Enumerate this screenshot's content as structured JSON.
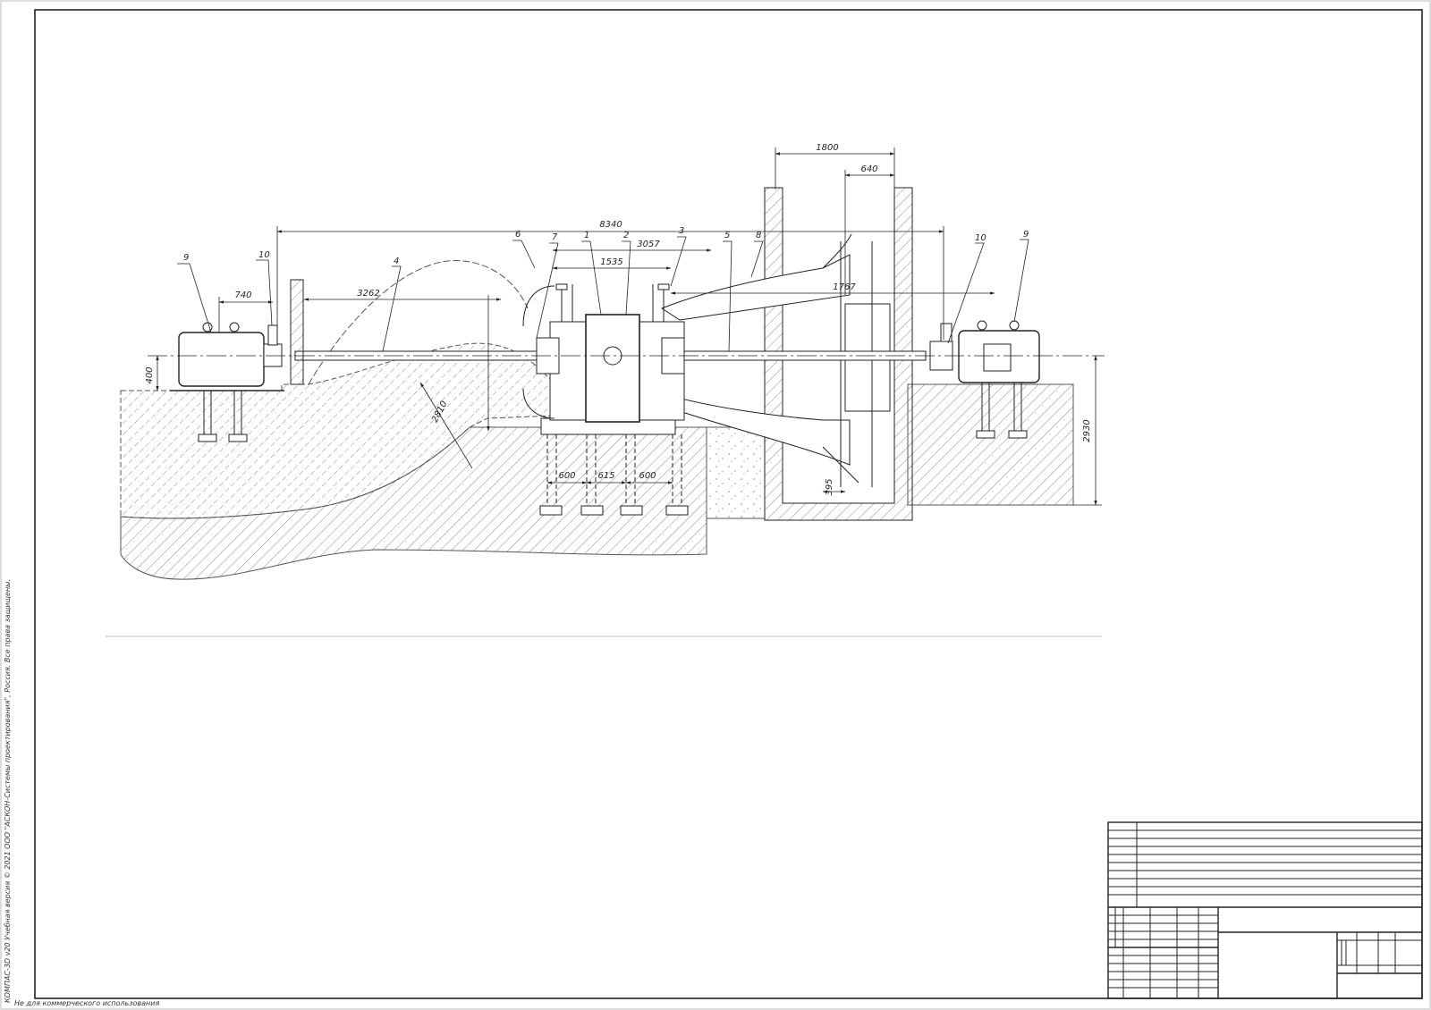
{
  "drawing": {
    "dimensions": {
      "d1800": "1800",
      "d640": "640",
      "d8340": "8340",
      "d3057": "3057",
      "d1535": "1535",
      "d1767": "1767",
      "d3262": "3262",
      "d740": "740",
      "d400": "400",
      "d2810": "2810",
      "d600a": "600",
      "d615": "615",
      "d600b": "600",
      "d395": "395",
      "d2930": "2930"
    },
    "callouts": {
      "c9_left": "9",
      "c10_left": "10",
      "c4": "4",
      "c6": "6",
      "c7": "7",
      "c1": "1",
      "c2": "2",
      "c3": "3",
      "c5": "5",
      "c8": "8",
      "c10_right": "10",
      "c9_right": "9"
    }
  },
  "margin_text": {
    "copyright": "КОМПАС-3D v20 Учебная версия © 2021 ООО \"АСКОН-Системы проектирования\", Россия. Все права защищены.",
    "noncommercial": "Не для коммерческого использования"
  },
  "colors": {
    "line": "#222222",
    "hatch": "#888888",
    "paper": "#ffffff"
  }
}
